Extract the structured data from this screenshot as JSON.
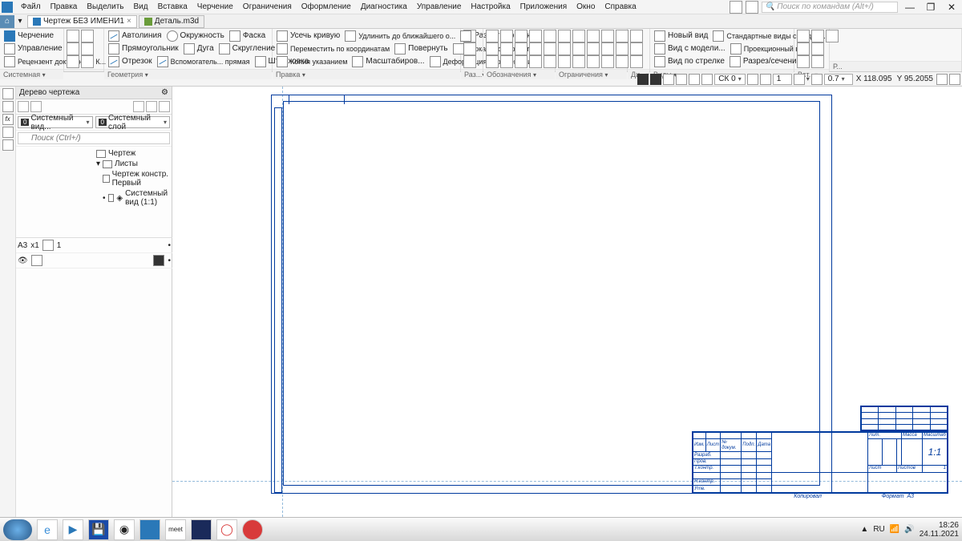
{
  "menu": {
    "items": [
      "Файл",
      "Правка",
      "Выделить",
      "Вид",
      "Вставка",
      "Черчение",
      "Ограничения",
      "Оформление",
      "Диагностика",
      "Управление",
      "Настройка",
      "Приложения",
      "Окно",
      "Справка"
    ],
    "search_placeholder": "Поиск по командам (Alt+/)"
  },
  "tabs": {
    "t1": "Чертеж БЕЗ ИМЕНИ1",
    "t2": "Деталь.m3d"
  },
  "ribbon": {
    "left_group": {
      "rows": [
        "Черчение",
        "Управление",
        "Рецензент документов К..."
      ],
      "title": "Системная"
    },
    "geom": {
      "autoline": "Автолиния",
      "rect": "Прямоугольник",
      "segment": "Отрезок",
      "circle": "Окружность",
      "arc": "Дуга",
      "aux_line": "Вспомогатель... прямая",
      "chamfer": "Фаска",
      "fillet": "Скругление",
      "hatch": "Штриховка",
      "title": "Геометрия"
    },
    "edit": {
      "trim": "Усечь кривую",
      "move_coord": "Переместить по координатам",
      "copy_point": "Копия указанием",
      "extend": "Удлинить до ближайшего о...",
      "rotate": "Повернуть",
      "scale": "Масштабиров...",
      "split": "Разбить кривую",
      "mirror": "Зеркально отразить",
      "deform": "Деформация перемещением",
      "title": "Правка"
    },
    "dims_title": "Раз...",
    "annot_title": "Обозначения",
    "constr_title": "Ограничения",
    "diag_title": "Ди...",
    "views": {
      "new_view": "Новый вид",
      "from_model": "Вид с модели...",
      "arrow_view": "Вид по стрелке",
      "std_views": "Стандартные виды с модели...",
      "proj_view": "Проекционный вид",
      "section": "Разрез/сечение",
      "title": "Виды"
    },
    "insert_title": "Вст...",
    "r_title": "Р..."
  },
  "toolbar2": {
    "layer_combo": "СК 0",
    "scale": "1",
    "zoom_val": "0.7",
    "coord_x": "X 118.095",
    "coord_y": "Y 95.2055"
  },
  "sidepanel": {
    "title": "Дерево чертежа",
    "view_combo_badge": "0",
    "view_combo": "Системный вид...",
    "layer_combo_badge": "0",
    "layer_combo": "Системный слой",
    "search_ph": "Поиск (Ctrl+/)",
    "tree": {
      "root": "Чертеж",
      "sheets": "Листы",
      "sheet1": "Чертеж констр. Первый",
      "view1": "Системный вид (1:1)"
    },
    "paper": "А3",
    "paper_scale": "x1",
    "paper_count": "1"
  },
  "titleblock": {
    "izm": "Изм.",
    "list": "Лист",
    "ndoc": "№ докум.",
    "podp": "Подп.",
    "data": "Дата",
    "razrab": "Разраб.",
    "prov": "Пров.",
    "tkontr": "Т.контр.",
    "nkontr": "Н.контр.",
    "utv": "Утв.",
    "lit": "Лит.",
    "massa": "Масса",
    "masshtab": "Масштаб",
    "scale_val": "1:1",
    "list2": "Лист",
    "listov": "Листов",
    "listov_val": "1",
    "kopiroval": "Копировал",
    "format": "Формат",
    "format_val": "А3"
  },
  "taskbar": {
    "lang": "RU",
    "time": "18:26",
    "date": "24.11.2021",
    "meet": "meet"
  }
}
